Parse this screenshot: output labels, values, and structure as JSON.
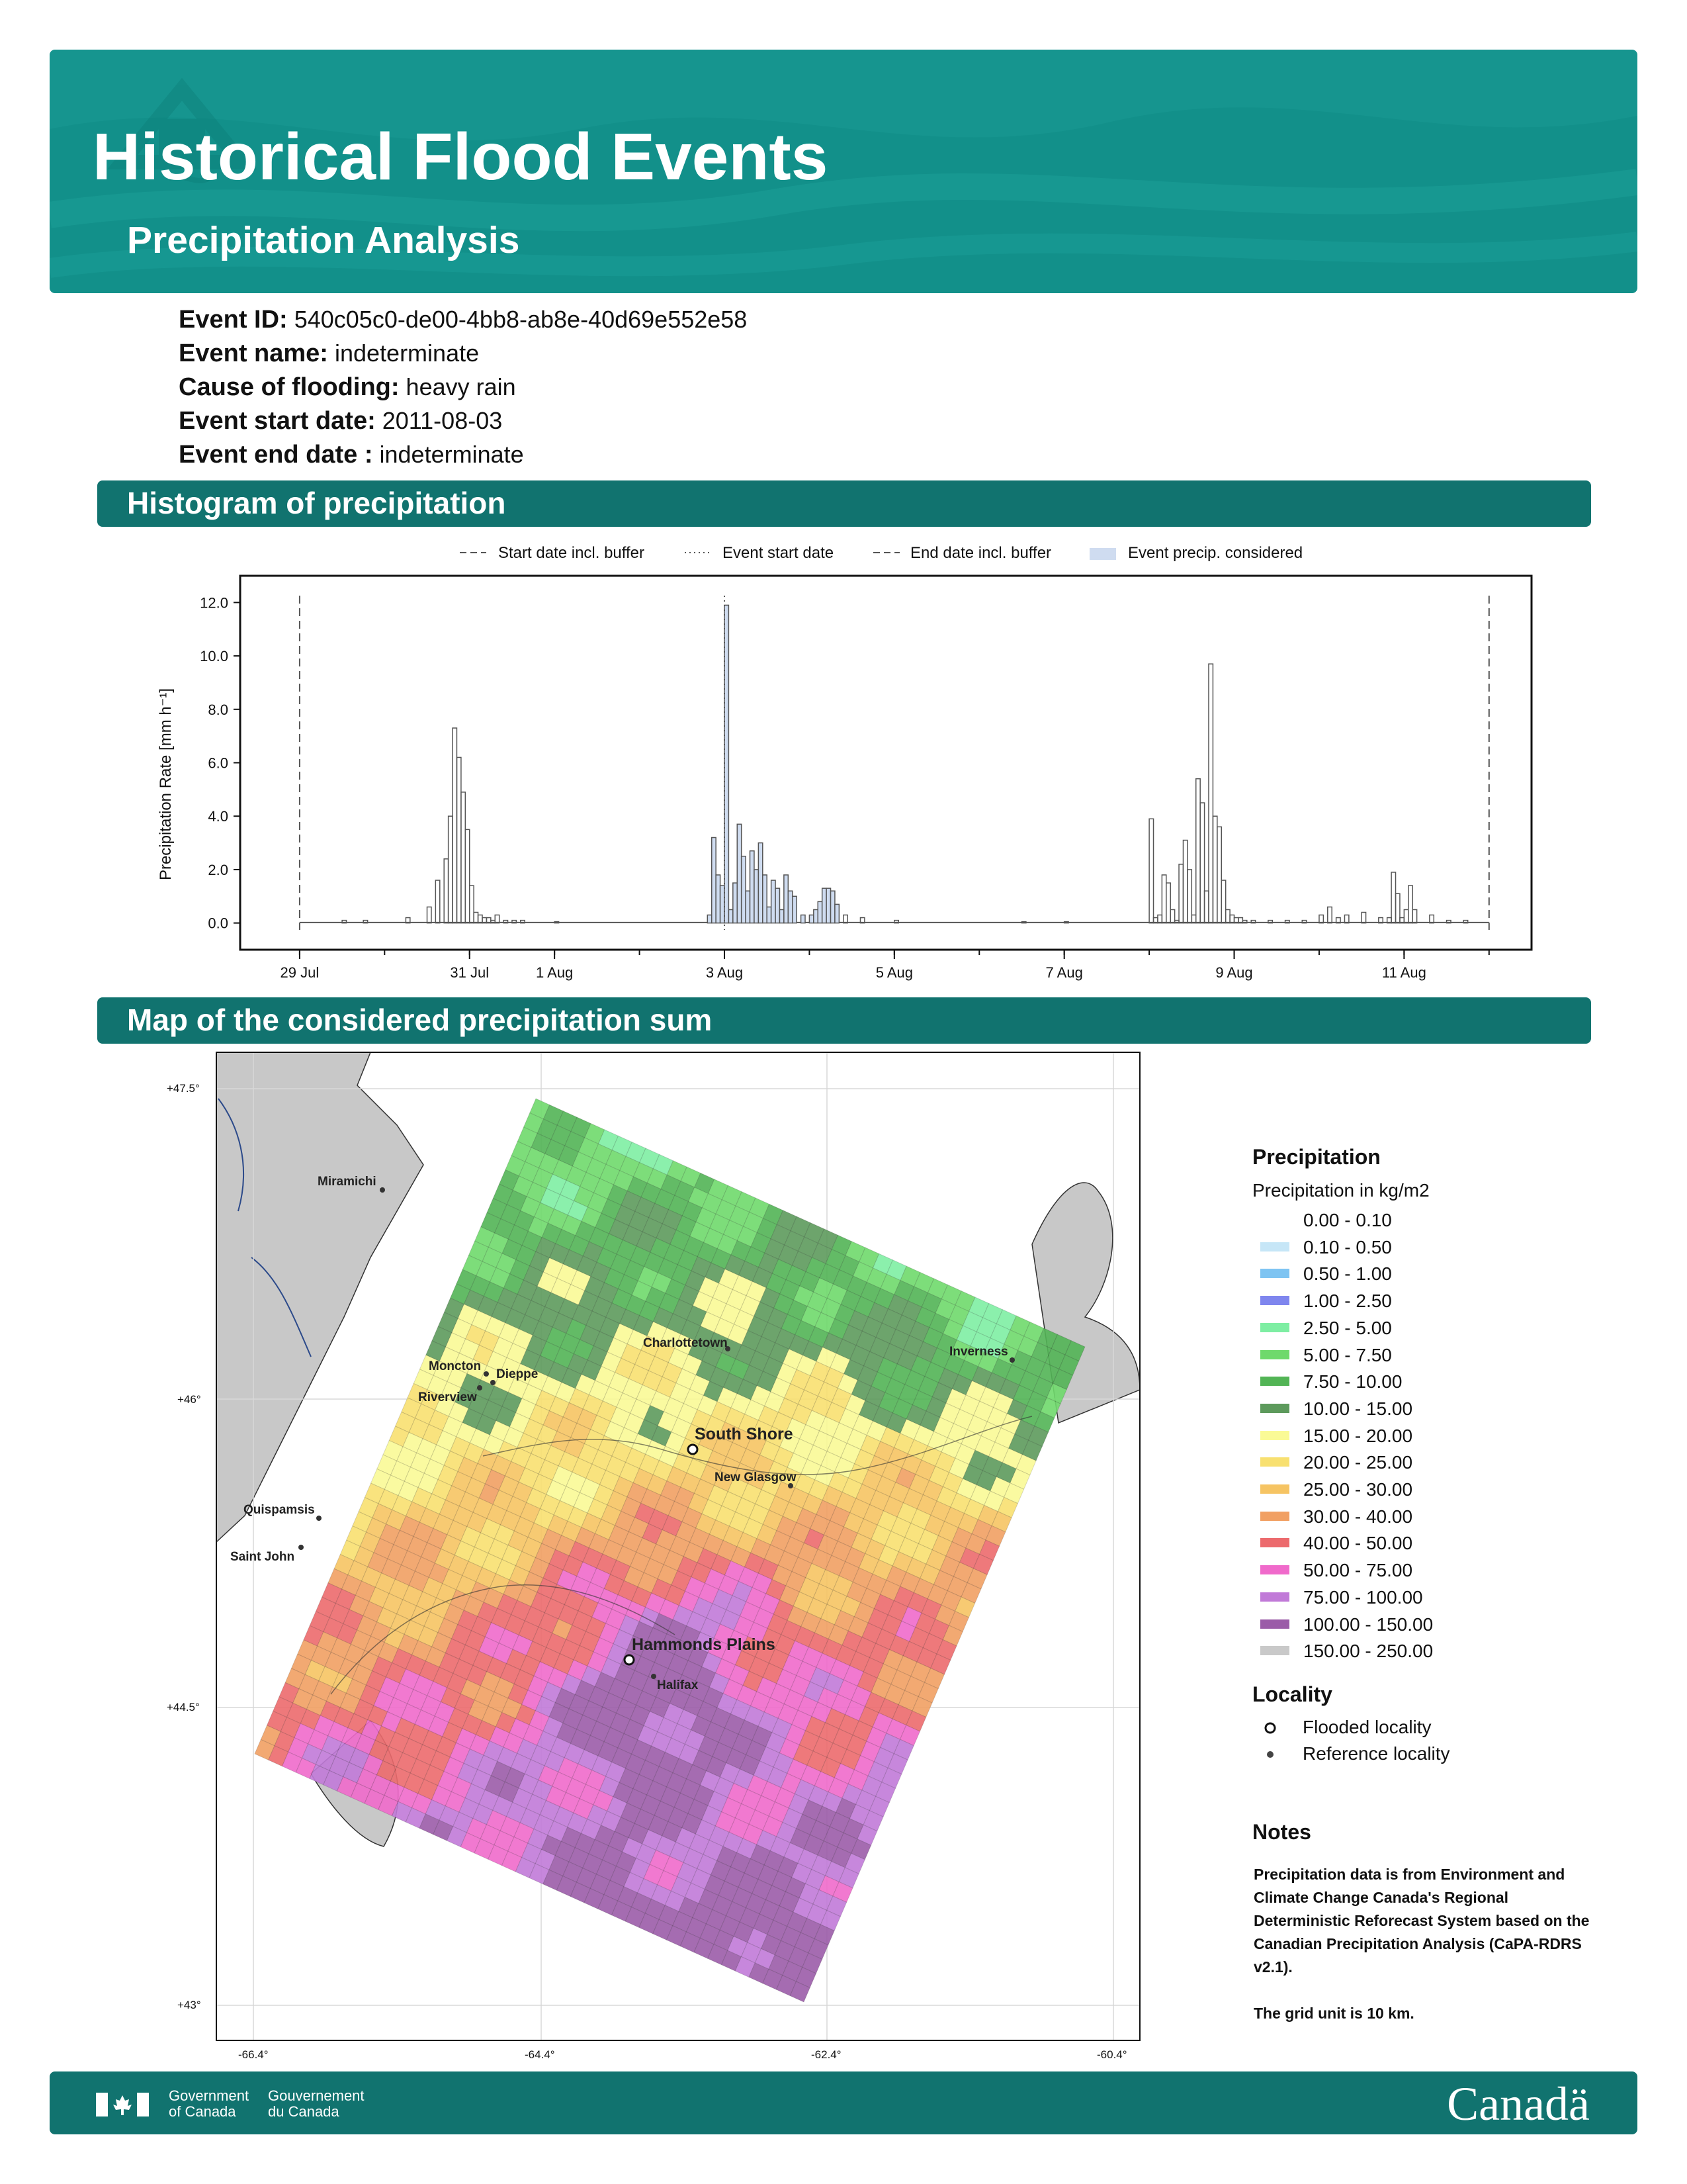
{
  "header": {
    "title": "Historical Flood Events",
    "subtitle": "Precipitation Analysis"
  },
  "event": {
    "id_label": "Event ID:",
    "id_value": "540c05c0-de00-4bb8-ab8e-40d69e552e58",
    "name_label": "Event name:",
    "name_value": "indeterminate",
    "cause_label": "Cause of flooding:",
    "cause_value": "heavy rain",
    "start_label": "Event start date:",
    "start_value": "2011-08-03",
    "end_label": "Event end date :",
    "end_value": "indeterminate"
  },
  "sections": {
    "histogram": "Histogram of precipitation",
    "map": "Map of the considered precipitation sum"
  },
  "histogram_legend": {
    "start_buffer": "Start date incl. buffer",
    "event_start": "Event start date",
    "end_buffer": "End date incl. buffer",
    "considered": "Event precip. considered"
  },
  "chart_data": {
    "type": "bar",
    "ylabel": "Precipitation Rate [mm h⁻¹]",
    "ylim": [
      -1,
      13
    ],
    "yticks": [
      "0.0",
      "2.0",
      "4.0",
      "6.0",
      "8.0",
      "10.0",
      "12.0"
    ],
    "x_ticks": [
      {
        "day": 0,
        "label": "29 Jul"
      },
      {
        "day": 2,
        "label": "31 Jul"
      },
      {
        "day": 3,
        "label": "1 Aug"
      },
      {
        "day": 5,
        "label": "3 Aug"
      },
      {
        "day": 7,
        "label": "5 Aug"
      },
      {
        "day": 9,
        "label": "7 Aug"
      },
      {
        "day": 11,
        "label": "9 Aug"
      },
      {
        "day": 13,
        "label": "11 Aug"
      }
    ],
    "xlim_days": [
      -0.7,
      14.5
    ],
    "start_buffer_day": 0,
    "event_start_day": 5,
    "end_buffer_day": 14,
    "considered_range_days": [
      4.75,
      6.3
    ],
    "series": [
      {
        "x": [
          0.5,
          0.75,
          1.25,
          1.5,
          1.6,
          1.7,
          1.75,
          1.8,
          1.85,
          1.9,
          1.95,
          2.0,
          2.05,
          2.1,
          2.15,
          2.2,
          2.25,
          2.3,
          2.4,
          2.5,
          2.6,
          3.0,
          4.8,
          4.85,
          4.9,
          4.95,
          5.0,
          5.05,
          5.1,
          5.15,
          5.2,
          5.25,
          5.3,
          5.35,
          5.4,
          5.45,
          5.5,
          5.55,
          5.6,
          5.65,
          5.7,
          5.75,
          5.8,
          5.9,
          6.0,
          6.05,
          6.1,
          6.15,
          6.2,
          6.25,
          6.3,
          6.4,
          6.6,
          7.0,
          8.5,
          9.0,
          10.0,
          10.05,
          10.1,
          10.15,
          10.2,
          10.25,
          10.3,
          10.35,
          10.4,
          10.45,
          10.5,
          10.55,
          10.6,
          10.65,
          10.7,
          10.75,
          10.8,
          10.85,
          10.9,
          10.95,
          11.0,
          11.05,
          11.1,
          11.2,
          11.4,
          11.6,
          11.8,
          12.0,
          12.1,
          12.2,
          12.3,
          12.5,
          12.7,
          12.8,
          12.85,
          12.9,
          12.95,
          13.0,
          13.05,
          13.1,
          13.3,
          13.5,
          13.7
        ],
        "values": [
          0.1,
          0.1,
          0.2,
          0.6,
          1.6,
          2.4,
          4.0,
          7.3,
          6.2,
          4.9,
          3.5,
          1.4,
          0.4,
          0.3,
          0.2,
          0.2,
          0.1,
          0.3,
          0.1,
          0.1,
          0.1,
          0.05,
          0.3,
          3.2,
          1.8,
          1.4,
          11.9,
          0.5,
          1.5,
          3.7,
          2.5,
          1.2,
          2.7,
          2.0,
          3.0,
          1.8,
          0.6,
          1.6,
          1.3,
          0.5,
          1.8,
          1.2,
          1.0,
          0.3,
          0.3,
          0.5,
          0.8,
          1.3,
          1.3,
          1.2,
          0.7,
          0.3,
          0.2,
          0.1,
          0.05,
          0.05,
          3.9,
          0.2,
          0.3,
          1.8,
          1.5,
          0.5,
          0.1,
          2.2,
          3.1,
          2.0,
          0.3,
          5.4,
          4.5,
          1.2,
          9.7,
          4.0,
          3.6,
          1.6,
          0.5,
          0.3,
          0.2,
          0.2,
          0.1,
          0.1,
          0.1,
          0.1,
          0.1,
          0.3,
          0.6,
          0.2,
          0.3,
          0.4,
          0.2,
          0.2,
          1.9,
          1.1,
          0.2,
          0.5,
          1.4,
          0.5,
          0.3,
          0.1,
          0.1
        ]
      }
    ]
  },
  "map": {
    "lat_labels": [
      "+47.5°",
      "+46°",
      "+44.5°",
      "+43°"
    ],
    "lon_labels": [
      "-66.4°",
      "-64.4°",
      "-62.4°",
      "-60.4°"
    ],
    "flooded_localities": [
      "South Shore",
      "Hammonds Plains"
    ],
    "reference_localities": [
      "Miramichi",
      "Charlottetown",
      "Inverness",
      "Moncton",
      "Dieppe",
      "Riverview",
      "New Glasgow",
      "Quispamsis",
      "Saint John",
      "Halifax"
    ]
  },
  "map_legend": {
    "title": "Precipitation",
    "subtitle": "Precipitation in kg/m2",
    "classes": [
      {
        "label": "0.00 - 0.10",
        "color": "#ffffff"
      },
      {
        "label": "0.10 - 0.50",
        "color": "#c6e6f7"
      },
      {
        "label": "0.50 - 1.00",
        "color": "#7ec4f2"
      },
      {
        "label": "1.00 - 2.50",
        "color": "#7f86ee"
      },
      {
        "label": "2.50 - 5.00",
        "color": "#7eeea3"
      },
      {
        "label": "5.00 - 7.50",
        "color": "#6fd96c"
      },
      {
        "label": "7.50 - 10.00",
        "color": "#52b455"
      },
      {
        "label": "10.00 - 15.00",
        "color": "#5d9a5c"
      },
      {
        "label": "15.00 - 20.00",
        "color": "#fafa96"
      },
      {
        "label": "20.00 - 25.00",
        "color": "#f8e070"
      },
      {
        "label": "25.00 - 30.00",
        "color": "#f6c463"
      },
      {
        "label": "30.00 - 40.00",
        "color": "#f1a063"
      },
      {
        "label": "40.00 - 50.00",
        "color": "#ec6a6d"
      },
      {
        "label": "50.00 - 75.00",
        "color": "#f06acb"
      },
      {
        "label": "75.00 - 100.00",
        "color": "#c17ad8"
      },
      {
        "label": "100.00 - 150.00",
        "color": "#9b5ca8"
      },
      {
        "label": "150.00 - 250.00",
        "color": "#c9c9c9"
      }
    ],
    "locality_title": "Locality",
    "flooded_label": "Flooded locality",
    "reference_label": "Reference locality"
  },
  "notes": {
    "title": "Notes",
    "paragraph1": "Precipitation data is from Environment and Climate Change Canada's Regional Deterministic Reforecast System based on the Canadian Precipitation Analysis (CaPA-RDRS v2.1).",
    "paragraph2": "The grid unit is 10 km."
  },
  "footer": {
    "gov_en_1": "Government",
    "gov_en_2": "of Canada",
    "gov_fr_1": "Gouvernement",
    "gov_fr_2": "du Canada",
    "wordmark": "Canadä"
  }
}
